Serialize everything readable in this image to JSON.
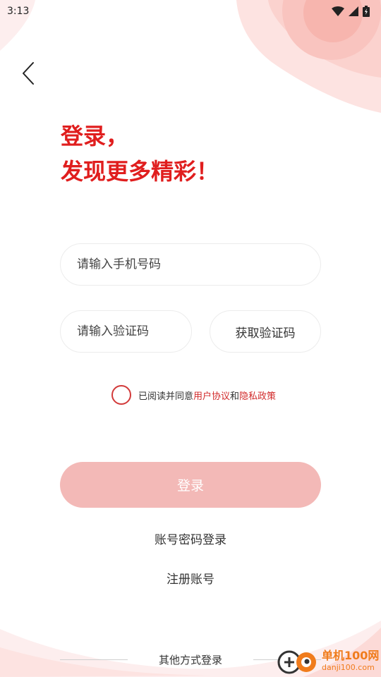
{
  "status_bar": {
    "time": "3:13"
  },
  "title": {
    "line1": "登录，",
    "line2": "发现更多精彩！"
  },
  "phone_field": {
    "placeholder": "请输入手机号码",
    "value": ""
  },
  "code_field": {
    "placeholder": "请输入验证码",
    "value": ""
  },
  "get_code_label": "获取验证码",
  "agreement": {
    "prefix": "已阅读并同意",
    "terms": "用户协议",
    "and": "和",
    "privacy": "隐私政策",
    "checked": false
  },
  "login_label": "登录",
  "password_login_label": "账号密码登录",
  "register_label": "注册账号",
  "other_login_label": "其他方式登录",
  "watermark": {
    "title": "单机100网",
    "sub": "danji100.com"
  },
  "icons": {
    "back": "chevron-left-icon",
    "wifi": "wifi-icon",
    "signal": "signal-icon",
    "battery": "battery-icon"
  },
  "colors": {
    "accent": "#e01e1e",
    "login_button": "#f3b9b7",
    "link": "#d22b2b"
  }
}
